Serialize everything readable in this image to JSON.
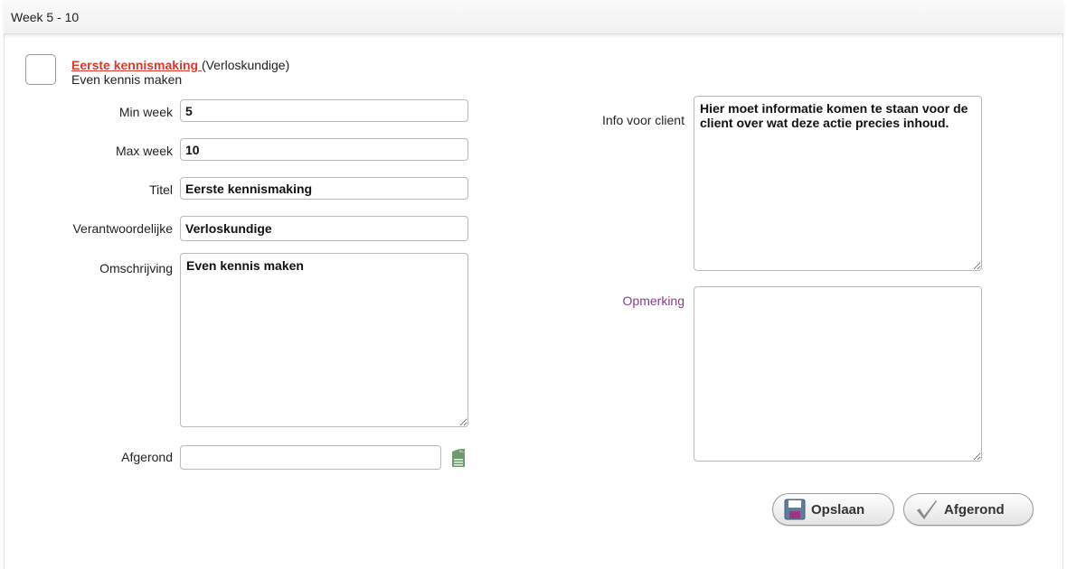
{
  "header": {
    "title": "Week 5 - 10"
  },
  "item": {
    "title_link": "Eerste kennismaking ",
    "role_suffix": "(Verloskundige)",
    "subtitle": "Even kennis maken"
  },
  "form": {
    "min_week": {
      "label": "Min week",
      "value": "5"
    },
    "max_week": {
      "label": "Max week",
      "value": "10"
    },
    "titel": {
      "label": "Titel",
      "value": "Eerste kennismaking"
    },
    "verantwoordelijke": {
      "label": "Verantwoordelijke",
      "value": "Verloskundige"
    },
    "omschrijving": {
      "label": "Omschrijving",
      "value": "Even kennis maken"
    },
    "afgerond": {
      "label": "Afgerond",
      "value": ""
    },
    "info_voor_client": {
      "label": "Info voor client",
      "value": "Hier moet informatie komen te staan voor de client over wat deze actie precies inhoud."
    },
    "opmerking": {
      "label": "Opmerking",
      "value": ""
    }
  },
  "buttons": {
    "save_label": "Opslaan",
    "complete_label": "Afgerond"
  },
  "icons": {
    "calendar": "calendar-icon",
    "save": "floppy-disk-icon",
    "complete": "checkmark-icon"
  },
  "colors": {
    "link_red": "#d9392c",
    "label_purple": "#8b3a8b",
    "calendar_green": "#6e9a6e"
  }
}
